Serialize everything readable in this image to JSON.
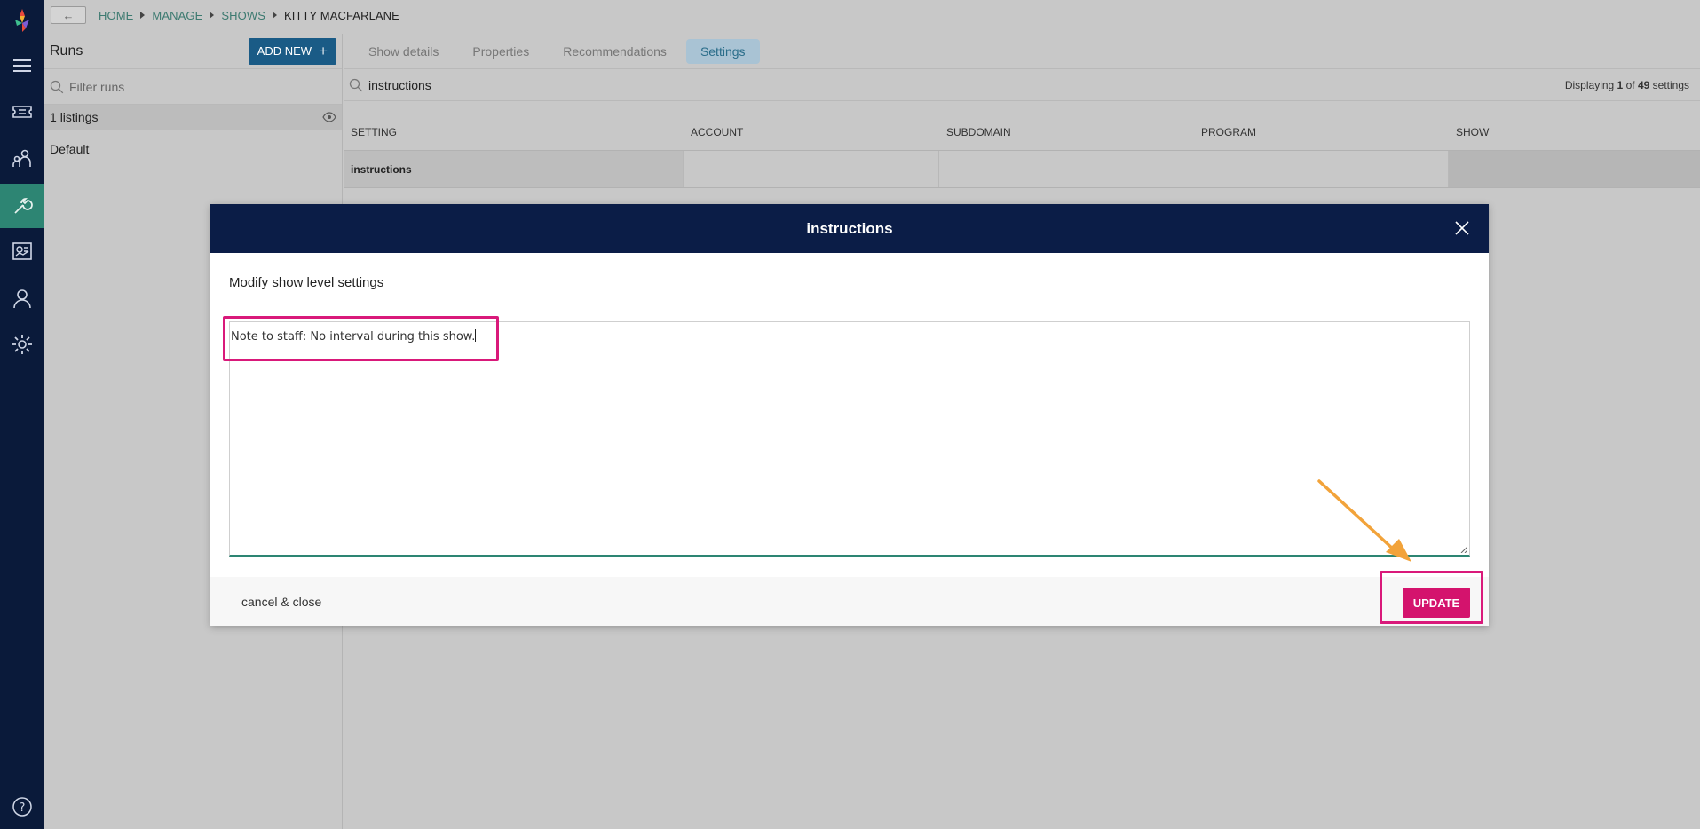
{
  "rail": {
    "icons": [
      "logo-icon",
      "menu-icon",
      "tickets-icon",
      "audience-icon",
      "tools-icon",
      "reports-icon",
      "user-icon",
      "settings-icon",
      "help-icon"
    ],
    "active": "tools-icon"
  },
  "breadcrumb": {
    "back_label": "←",
    "items": [
      "HOME",
      "MANAGE",
      "SHOWS",
      "KITTY MACFARLANE"
    ]
  },
  "runs": {
    "title": "Runs",
    "add_new_label": "ADD NEW",
    "add_new_plus": "+",
    "filter_placeholder": "Filter runs",
    "listings_count": "1",
    "listings_label": "listings",
    "default_label": "Default"
  },
  "tabs": [
    {
      "label": "Show details",
      "active": false
    },
    {
      "label": "Properties",
      "active": false
    },
    {
      "label": "Recommendations",
      "active": false
    },
    {
      "label": "Settings",
      "active": true
    }
  ],
  "search": {
    "value": "instructions",
    "display_prefix": "Displaying",
    "display_current": "1",
    "display_of": "of",
    "display_total": "49",
    "display_suffix": "settings"
  },
  "table": {
    "headers": [
      "SETTING",
      "ACCOUNT",
      "SUBDOMAIN",
      "PROGRAM",
      "SHOW"
    ],
    "rows": [
      {
        "setting": "instructions",
        "account": "",
        "subdomain": "",
        "program": "",
        "show": ""
      }
    ]
  },
  "modal": {
    "title": "instructions",
    "subtitle": "Modify show level settings",
    "textarea_value": "Note to staff: No interval during this show.",
    "cancel_label": "cancel & close",
    "update_label": "UPDATE"
  },
  "colors": {
    "rail_bg": "#0a1a3a",
    "rail_active": "#2d8573",
    "modal_header": "#0b1d47",
    "update_button": "#d4136d",
    "highlight": "#d9197a",
    "arrow": "#f2a33a"
  }
}
